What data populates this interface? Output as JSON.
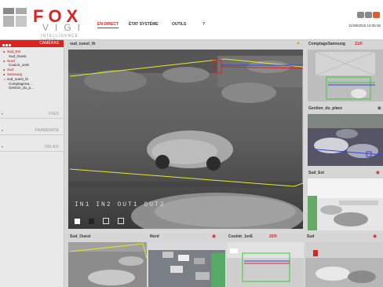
{
  "app": {
    "brand": "FOX",
    "brand_sub": "VIGI",
    "tagline": "INTELLIGENCE VIDEO",
    "datetime": "11/08/2015 14:05:36"
  },
  "nav": {
    "items": [
      "EN DIRECT",
      "ÉTAT SYSTÈME",
      "OUTILS",
      "?"
    ],
    "active": "EN DIRECT"
  },
  "sidebar": {
    "cameras_header": "CAMÉRAS",
    "cameras": [
      {
        "label": "Sud_Est",
        "level": 0,
        "icon": "camera-icon"
      },
      {
        "label": "Sud_Ouest",
        "level": 1,
        "icon": "camera-icon"
      },
      {
        "label": "Nord",
        "level": 0,
        "icon": "camera-icon"
      },
      {
        "label": "Couloir_1erE",
        "level": 1,
        "icon": "camera-icon"
      },
      {
        "label": "Sud",
        "level": 0,
        "icon": "camera-icon"
      },
      {
        "label": "Samsung",
        "level": 0,
        "icon": "camera-icon"
      },
      {
        "label": "sud_ouest_th",
        "level": 0,
        "icon": "warning-icon"
      },
      {
        "label": "ComptageSa...",
        "level": 1,
        "icon": ""
      },
      {
        "label": "Gestion_du_p...",
        "level": 1,
        "icon": ""
      }
    ],
    "sections": [
      "VUES",
      "FRAMERATE",
      "RELAIS"
    ]
  },
  "main_view": {
    "title": "sud_ouest_th",
    "counter_labels": [
      "IN",
      "IN",
      "OUT",
      "OUT"
    ]
  },
  "side_views": [
    {
      "title": "ComptageSamsung",
      "count": "21/0"
    },
    {
      "title": "Gestion_du_place"
    },
    {
      "title": "Sud_Est"
    }
  ],
  "bottom_views": [
    {
      "title": "Sud_Ouest"
    },
    {
      "title": "Nord"
    },
    {
      "title": "Couloir_1erE",
      "count": "20/0"
    },
    {
      "title": "Sud"
    }
  ],
  "colors": {
    "accent": "#dd2222",
    "zone_yellow": "#e8e82a",
    "line_blue": "#3344dd",
    "line_green": "#33cc33"
  }
}
